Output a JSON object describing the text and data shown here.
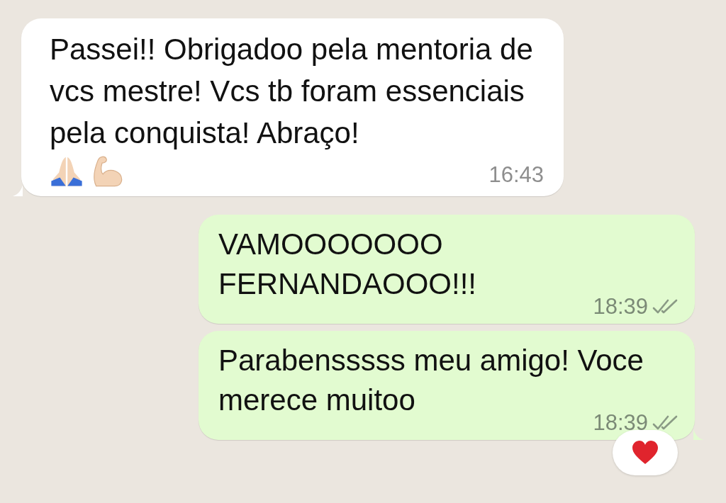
{
  "messages": [
    {
      "kind": "incoming",
      "text": "Passei!! Obrigadoo pela mentoria de vcs mestre! Vcs tb foram essenciais pela conquista! Abraço!",
      "emojis": [
        {
          "kind": "praying-hands"
        },
        {
          "kind": "flexed-biceps"
        }
      ],
      "time": "16:43",
      "tail": true
    },
    {
      "kind": "outgoing",
      "text": "VAMOOOOOOO FERNANDAOOO!!!",
      "time": "18:39",
      "read": false,
      "tail": false
    },
    {
      "kind": "outgoing",
      "text": "Parabensssss meu amigo! Voce merece muitoo",
      "time": "18:39",
      "read": false,
      "tail": true,
      "reaction": {
        "kind": "heart"
      }
    }
  ]
}
